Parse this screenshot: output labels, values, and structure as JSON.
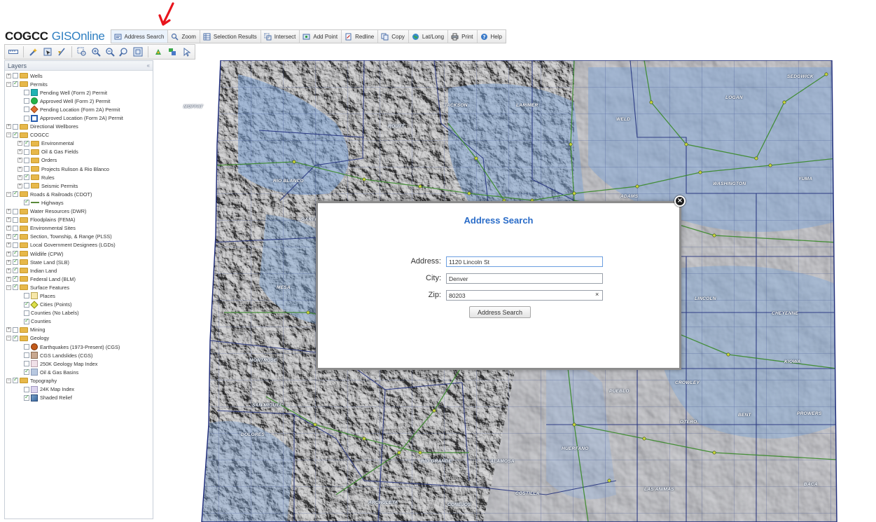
{
  "app": {
    "logo_main": "COGCC",
    "logo_sub": "GISOnline"
  },
  "toolbar": [
    {
      "label": "Address Search",
      "icon": "address-search-icon"
    },
    {
      "label": "Zoom",
      "icon": "zoom-icon"
    },
    {
      "label": "Selection Results",
      "icon": "selection-results-icon"
    },
    {
      "label": "Intersect",
      "icon": "intersect-icon"
    },
    {
      "label": "Add Point",
      "icon": "add-point-icon"
    },
    {
      "label": "Redline",
      "icon": "redline-icon"
    },
    {
      "label": "Copy",
      "icon": "copy-icon"
    },
    {
      "label": "Lat/Long",
      "icon": "globe-icon"
    },
    {
      "label": "Print",
      "icon": "print-icon"
    },
    {
      "label": "Help",
      "icon": "help-icon"
    }
  ],
  "layers": {
    "title": "Layers",
    "items": [
      {
        "label": "Wells",
        "level": 0,
        "expander": "+",
        "checked": false,
        "sym": "folder"
      },
      {
        "label": "Permits",
        "level": 0,
        "expander": "-",
        "checked": true,
        "sym": "folder"
      },
      {
        "label": "Pending Well (Form 2) Permit",
        "level": 1,
        "expander": "",
        "checked": false,
        "sym": "sym-sq-teal"
      },
      {
        "label": "Approved Well (Form 2) Permit",
        "level": 1,
        "expander": "",
        "checked": false,
        "sym": "sym-circ-green"
      },
      {
        "label": "Pending Location (Form 2A) Permit",
        "level": 1,
        "expander": "",
        "checked": false,
        "sym": "sym-diamond"
      },
      {
        "label": "Approved Location (Form 2A) Permit",
        "level": 1,
        "expander": "",
        "checked": false,
        "sym": "sym-sq-outline"
      },
      {
        "label": "Directional Wellbores",
        "level": 0,
        "expander": "+",
        "checked": false,
        "sym": "folder"
      },
      {
        "label": "COGCC",
        "level": 0,
        "expander": "-",
        "checked": true,
        "sym": "folder"
      },
      {
        "label": "Environmental",
        "level": 1,
        "expander": "+",
        "checked": true,
        "sym": "folder"
      },
      {
        "label": "Oil & Gas Fields",
        "level": 1,
        "expander": "+",
        "checked": false,
        "sym": "folder"
      },
      {
        "label": "Orders",
        "level": 1,
        "expander": "+",
        "checked": false,
        "sym": "folder"
      },
      {
        "label": "Projects Rulison & Rio Blanco",
        "level": 1,
        "expander": "+",
        "checked": false,
        "sym": "folder"
      },
      {
        "label": "Rules",
        "level": 1,
        "expander": "+",
        "checked": true,
        "sym": "folder"
      },
      {
        "label": "Seismic Permits",
        "level": 1,
        "expander": "+",
        "checked": false,
        "sym": "folder"
      },
      {
        "label": "Roads & Railroads (CDOT)",
        "level": 0,
        "expander": "-",
        "checked": true,
        "sym": "folder"
      },
      {
        "label": "Highways",
        "level": 1,
        "expander": "",
        "checked": true,
        "sym": "sym-line"
      },
      {
        "label": "Water Resources (DWR)",
        "level": 0,
        "expander": "+",
        "checked": false,
        "sym": "folder"
      },
      {
        "label": "Floodplains (FEMA)",
        "level": 0,
        "expander": "+",
        "checked": false,
        "sym": "folder"
      },
      {
        "label": "Environmental Sites",
        "level": 0,
        "expander": "+",
        "checked": false,
        "sym": "folder"
      },
      {
        "label": "Section, Township, & Range (PLSS)",
        "level": 0,
        "expander": "+",
        "checked": true,
        "sym": "folder"
      },
      {
        "label": "Local Government Designees (LGDs)",
        "level": 0,
        "expander": "+",
        "checked": false,
        "sym": "folder"
      },
      {
        "label": "Wildlife (CPW)",
        "level": 0,
        "expander": "+",
        "checked": true,
        "sym": "folder"
      },
      {
        "label": "State Land (SLB)",
        "level": 0,
        "expander": "+",
        "checked": true,
        "sym": "folder"
      },
      {
        "label": "Indian Land",
        "level": 0,
        "expander": "+",
        "checked": true,
        "sym": "folder"
      },
      {
        "label": "Federal Land (BLM)",
        "level": 0,
        "expander": "+",
        "checked": true,
        "sym": "folder"
      },
      {
        "label": "Surface Features",
        "level": 0,
        "expander": "-",
        "checked": true,
        "sym": "folder"
      },
      {
        "label": "Places",
        "level": 1,
        "expander": "",
        "checked": false,
        "sym": "sym-box-yellow"
      },
      {
        "label": "Cities (Points)",
        "level": 1,
        "expander": "",
        "checked": true,
        "sym": "sym-diamond-y"
      },
      {
        "label": "Counties (No Labels)",
        "level": 1,
        "expander": "",
        "checked": false,
        "sym": "none"
      },
      {
        "label": "Counties",
        "level": 1,
        "expander": "",
        "checked": true,
        "sym": "none"
      },
      {
        "label": "Mining",
        "level": 0,
        "expander": "+",
        "checked": false,
        "sym": "folder"
      },
      {
        "label": "Geology",
        "level": 0,
        "expander": "-",
        "checked": true,
        "sym": "folder"
      },
      {
        "label": "Earthquakes (1973-Present) (CGS)",
        "level": 1,
        "expander": "",
        "checked": false,
        "sym": "sym-circ-brown"
      },
      {
        "label": "CGS Landslides (CGS)",
        "level": 1,
        "expander": "",
        "checked": false,
        "sym": "sym-box-tan"
      },
      {
        "label": "250K Geology Map Index",
        "level": 1,
        "expander": "",
        "checked": false,
        "sym": "sym-box-lpink"
      },
      {
        "label": "Oil & Gas Basins",
        "level": 1,
        "expander": "",
        "checked": true,
        "sym": "sym-box-blue"
      },
      {
        "label": "Topography",
        "level": 0,
        "expander": "-",
        "checked": true,
        "sym": "folder"
      },
      {
        "label": "24K Map Index",
        "level": 1,
        "expander": "",
        "checked": false,
        "sym": "sym-box-lav"
      },
      {
        "label": "Shaded Relief",
        "level": 1,
        "expander": "",
        "checked": true,
        "sym": "sym-box-relief"
      }
    ]
  },
  "map": {
    "county_labels": [
      "SEDGWICK",
      "LOGAN",
      "MOFFAT",
      "JACKSON",
      "LARIMER",
      "ROUTT",
      "WELD",
      "RIO BLANCO",
      "ADAMS",
      "WASHINGTON",
      "YUMA",
      "GARFIELD",
      "MESA",
      "LINCOLN",
      "CHEYENNE",
      "MONTROSE",
      "KIOWA",
      "CROWLEY",
      "PUEBLO",
      "SAN MIGUEL",
      "OTERO",
      "BENT",
      "PROWERS",
      "DOLORES",
      "HUERFANO",
      "RIO GRANDE",
      "ALAMOSA",
      "LAS ANIMAS",
      "BACA",
      "COSTILLA",
      "ARCHULETA",
      "CONEJOS"
    ]
  },
  "modal": {
    "title": "Address Search",
    "address_label": "Address:",
    "address_value": "1120 Lincoln St",
    "city_label": "City:",
    "city_value": "Denver",
    "zip_label": "Zip:",
    "zip_value": "80203",
    "clear_glyph": "×",
    "button_label": "Address Search",
    "close_glyph": "×"
  },
  "colors": {
    "accent_blue": "#2a6cc8",
    "logo_blue": "#2f7fc1",
    "annotation_red": "#e8141c"
  }
}
